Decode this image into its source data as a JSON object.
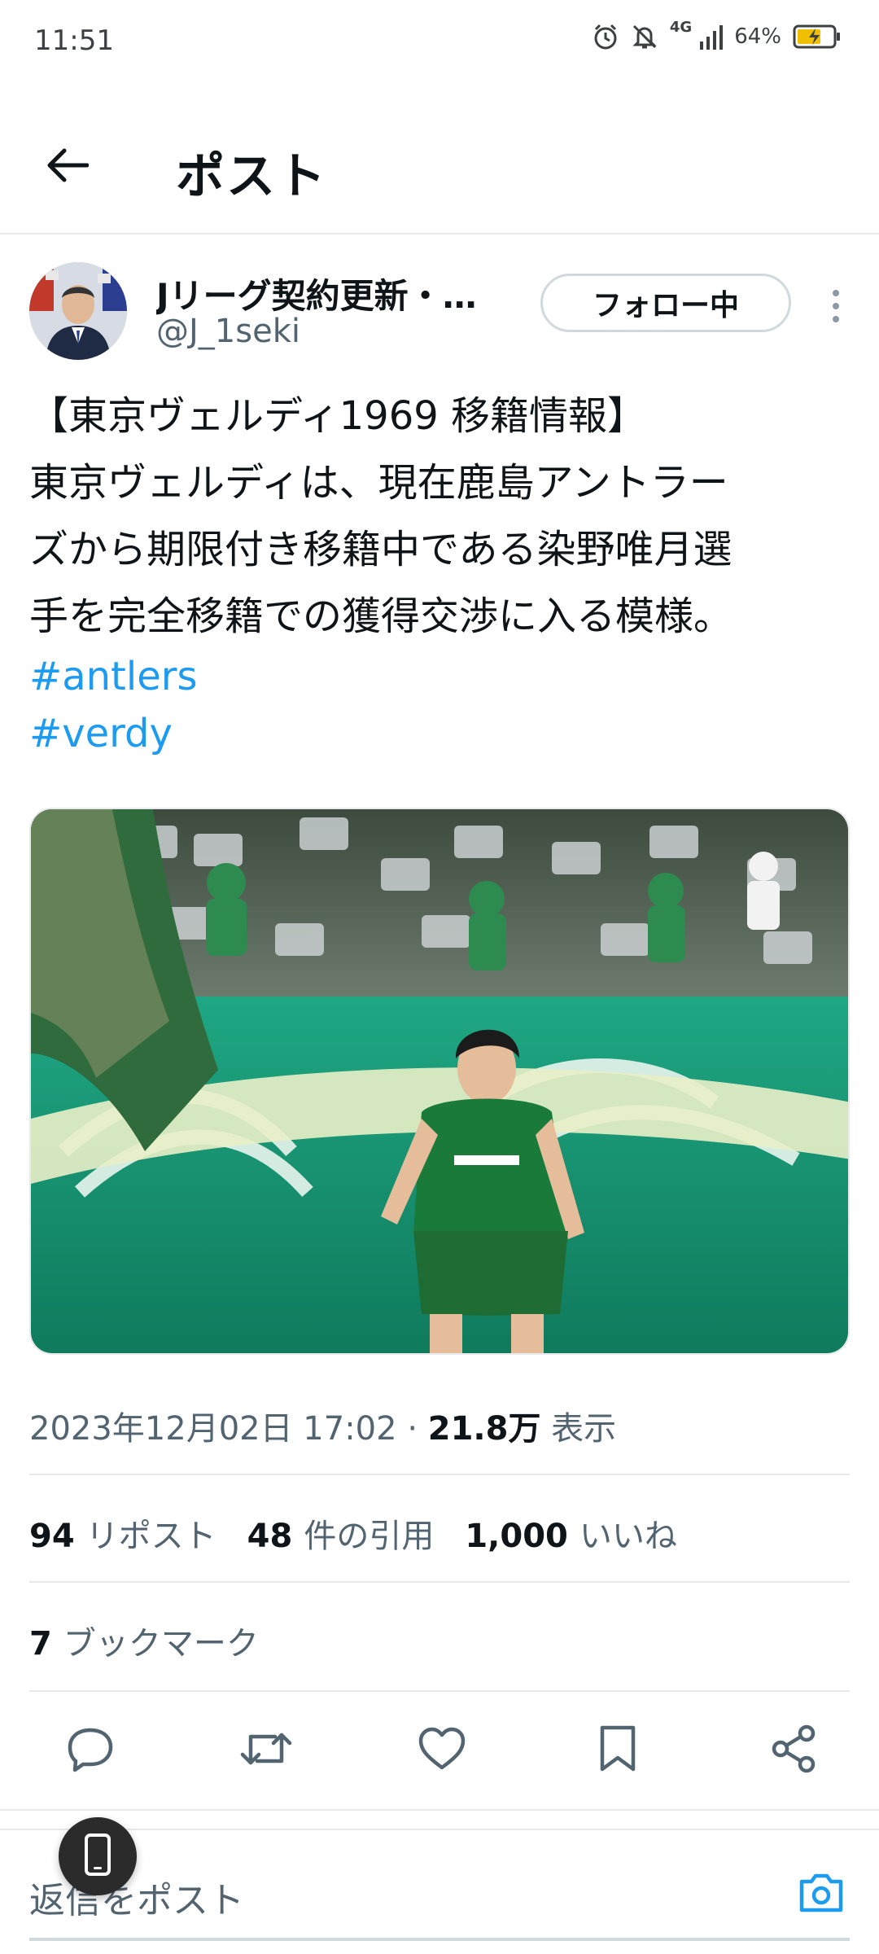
{
  "status_bar": {
    "time": "11:51",
    "network": "4G",
    "battery_percent": "64%",
    "icons": [
      "alarm-icon",
      "bell-off-icon",
      "signal-icon",
      "battery-charging-icon"
    ]
  },
  "header": {
    "title": "ポスト",
    "back_icon": "arrow-left-icon"
  },
  "author": {
    "display_name": "Jリーグ契約更新・…",
    "handle": "@J_1seki",
    "follow_label": "フォロー中",
    "more_icon": "more-vertical-icon"
  },
  "tweet": {
    "text_lines": [
      "【東京ヴェルディ1969 移籍情報】",
      "東京ヴェルディは、現在鹿島アントラー",
      "ズから期限付き移籍中である染野唯月選",
      "手を完全移籍での獲得交渉に入る模様。"
    ],
    "hashtags": [
      "#antlers",
      "#verdy"
    ]
  },
  "meta": {
    "timestamp": "2023年12月02日 17:02",
    "separator": "·",
    "views_count": "21.8万",
    "views_label": "表示"
  },
  "stats": {
    "reposts_count": "94",
    "reposts_label": "リポスト",
    "quotes_count": "48",
    "quotes_label": "件の引用",
    "likes_count": "1,000",
    "likes_label": "いいね",
    "bookmarks_count": "7",
    "bookmarks_label": "ブックマーク"
  },
  "actions": [
    "reply-icon",
    "repost-icon",
    "like-icon",
    "bookmark-icon",
    "share-icon"
  ],
  "reply_bar": {
    "placeholder": "返信をポスト",
    "camera_icon": "camera-icon"
  },
  "colors": {
    "accent": "#1d9bf0",
    "text_primary": "#0f1419",
    "text_secondary": "#536471",
    "divider": "#e7e9ea"
  }
}
